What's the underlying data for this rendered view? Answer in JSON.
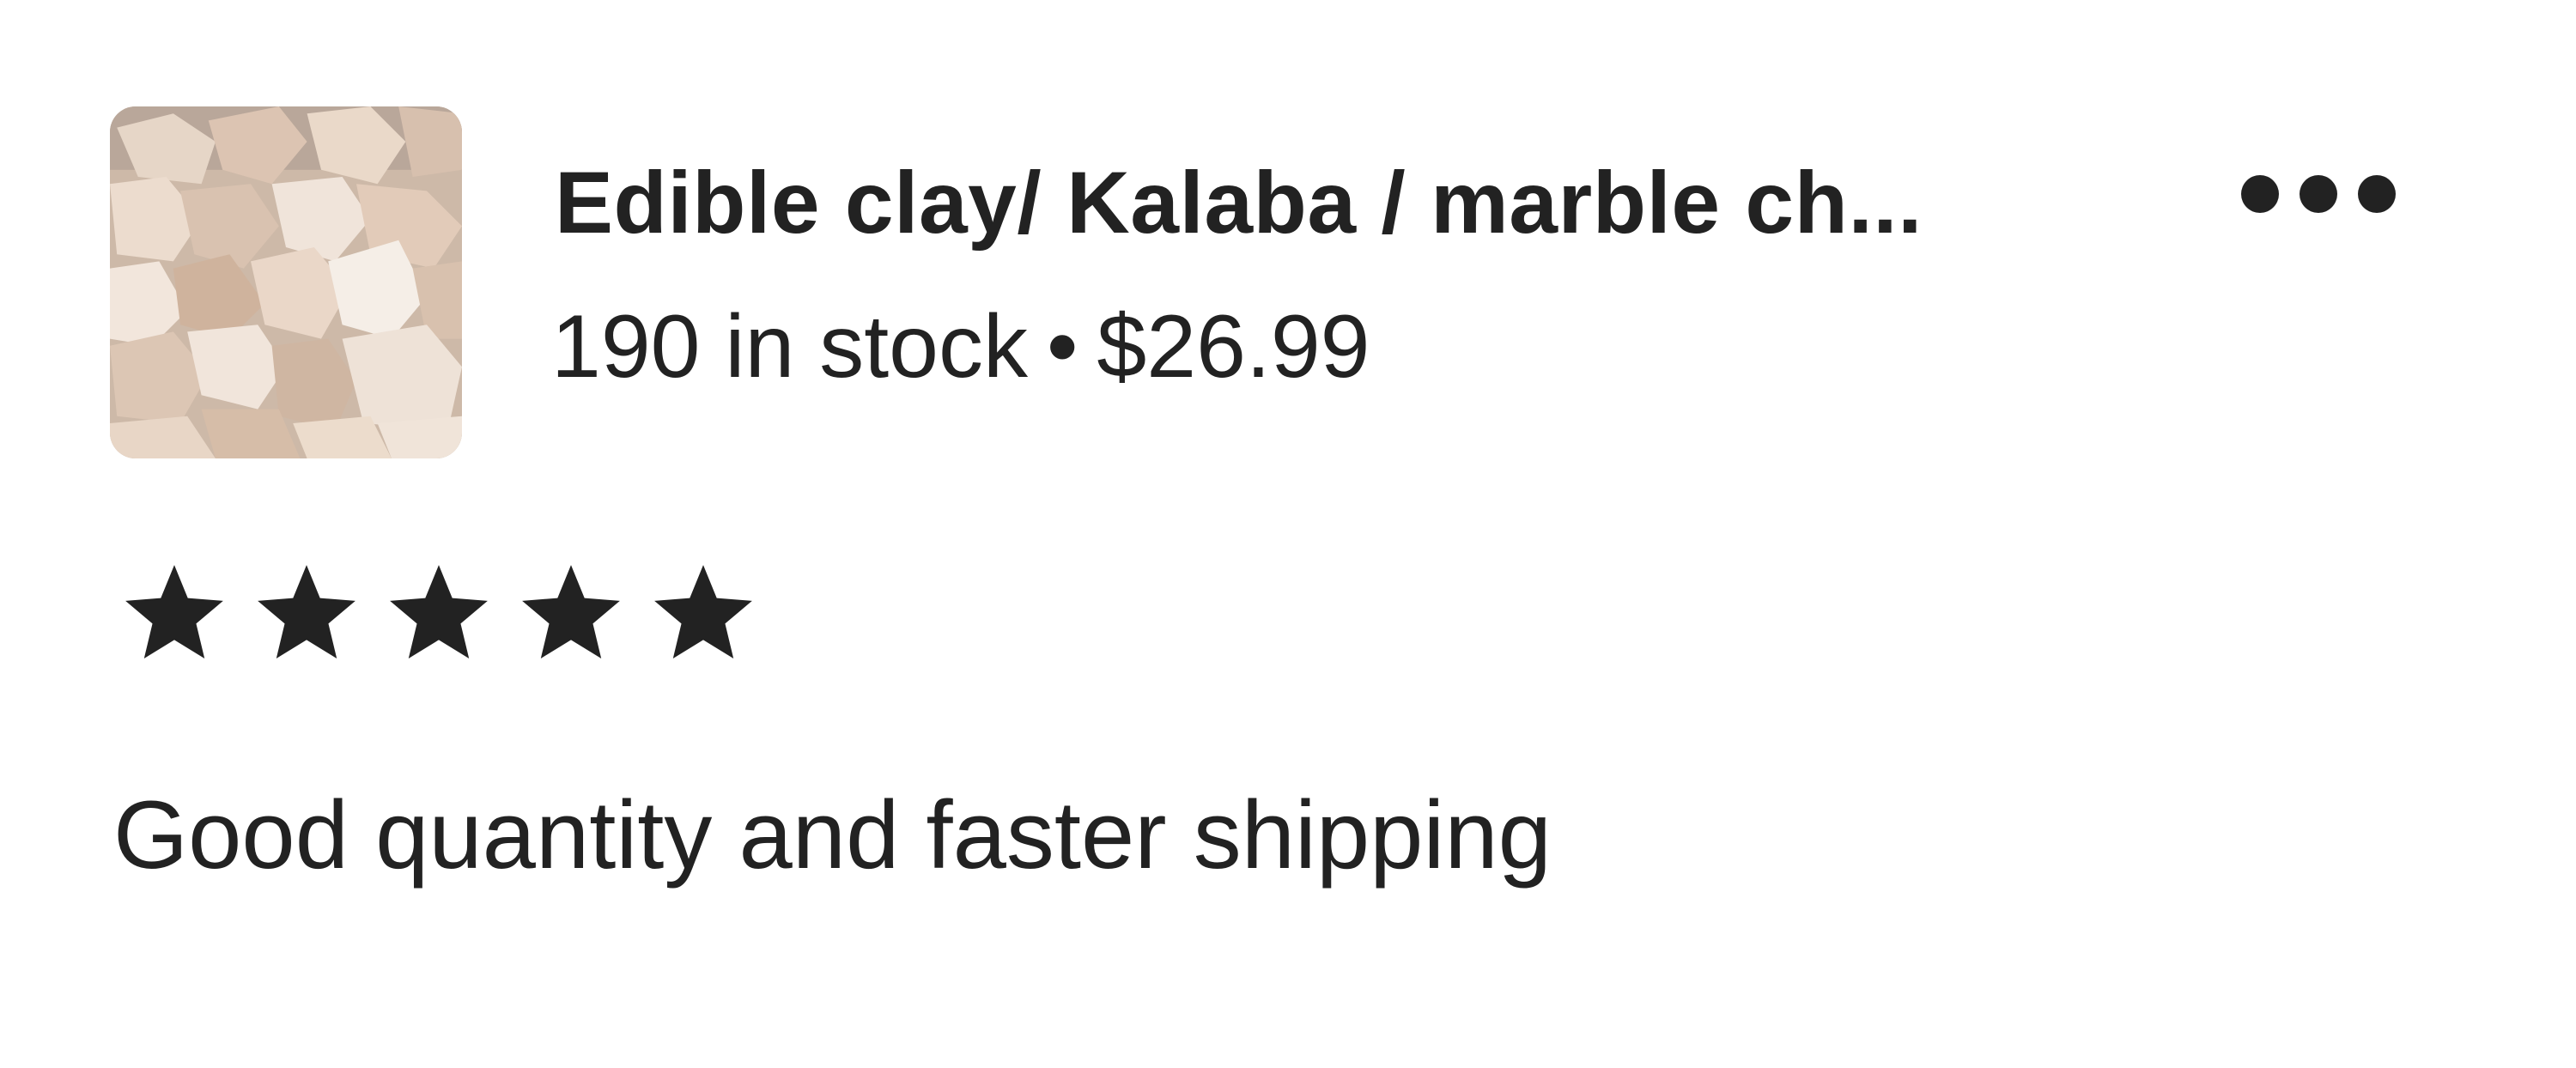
{
  "listing": {
    "image_icon": "product-photo-clay-chunks",
    "title": "Edible clay/ Kalaba / marble ch...",
    "stock": "190 in stock",
    "separator": "•",
    "price": "$26.99"
  },
  "menu": {
    "icon": "more-options-icon"
  },
  "review": {
    "rating": 5,
    "rating_max": 5,
    "star_icon": "star-filled-icon",
    "text": "Good quantity and faster shipping"
  },
  "colors": {
    "text": "#222222",
    "background": "#ffffff"
  }
}
